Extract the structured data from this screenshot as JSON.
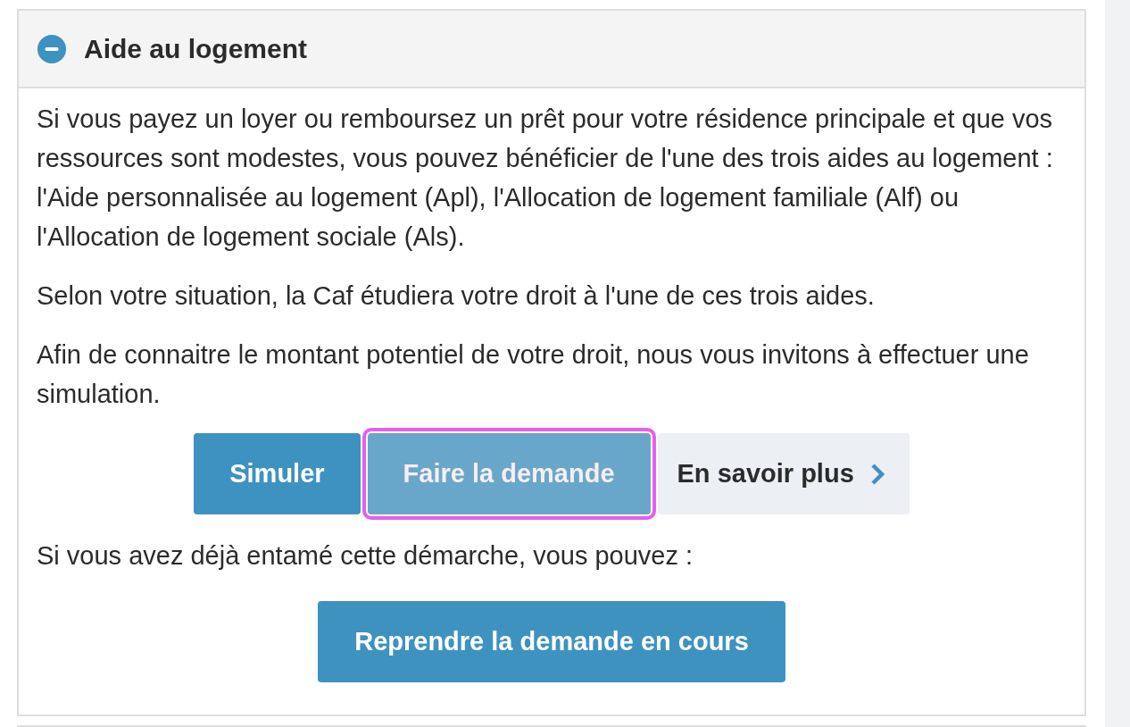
{
  "panel": {
    "title": "Aide au logement",
    "expanded": true
  },
  "paragraphs": [
    "Si vous payez un loyer ou remboursez un prêt pour votre résidence principale et que vos ressources sont modestes, vous pouvez bénéficier de l'une des trois aides au logement : l'Aide personnalisée au logement (Apl), l'Allocation de logement familiale (Alf) ou l'Allocation de logement sociale (Als).",
    "Selon votre situation, la Caf étudiera votre droit à l'une de ces trois aides.",
    "Afin de connaitre le montant potentiel de votre droit, nous vous invitons à effectuer une simulation."
  ],
  "buttons": [
    {
      "label": "Simuler",
      "kind": "primary",
      "highlighted": false
    },
    {
      "label": "Faire la demande",
      "kind": "muted",
      "highlighted": true
    },
    {
      "label": "En savoir plus",
      "kind": "more",
      "highlighted": false
    }
  ],
  "resume_intro": "Si vous avez déjà entamé cette démarche, vous pouvez :",
  "resume_button": {
    "label": "Reprendre la demande en cours"
  }
}
